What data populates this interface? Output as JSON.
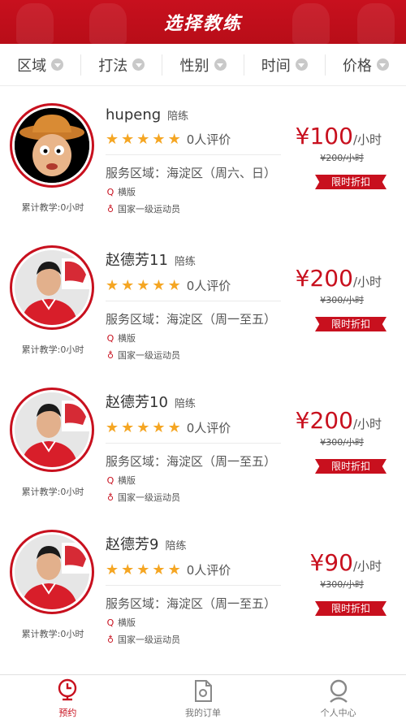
{
  "header": {
    "title": "选择教练"
  },
  "filters": [
    {
      "label": "区域"
    },
    {
      "label": "打法"
    },
    {
      "label": "性别"
    },
    {
      "label": "时间"
    },
    {
      "label": "价格"
    }
  ],
  "coaches": [
    {
      "name": "hupeng",
      "tag": "陪练",
      "stars": 5,
      "reviews": "0人评价",
      "area": "服务区域：海淀区（周六、日）",
      "style": "横版",
      "level": "国家一级运动员",
      "price": "¥100",
      "unit": "/小时",
      "old_price": "¥200/小时",
      "discount": "限时折扣",
      "total_teach": "累计教学:0小时",
      "avatar": "cartoon"
    },
    {
      "name": "赵德芳11",
      "tag": "陪练",
      "stars": 5,
      "reviews": "0人评价",
      "area": "服务区域：海淀区（周一至五）",
      "style": "横版",
      "level": "国家一级运动员",
      "price": "¥200",
      "unit": "/小时",
      "old_price": "¥300/小时",
      "discount": "限时折扣",
      "total_teach": "累计教学:0小时",
      "avatar": "photo"
    },
    {
      "name": "赵德芳10",
      "tag": "陪练",
      "stars": 5,
      "reviews": "0人评价",
      "area": "服务区域：海淀区（周一至五）",
      "style": "横版",
      "level": "国家一级运动员",
      "price": "¥200",
      "unit": "/小时",
      "old_price": "¥300/小时",
      "discount": "限时折扣",
      "total_teach": "累计教学:0小时",
      "avatar": "photo"
    },
    {
      "name": "赵德芳9",
      "tag": "陪练",
      "stars": 5,
      "reviews": "0人评价",
      "area": "服务区域：海淀区（周一至五）",
      "style": "横版",
      "level": "国家一级运动员",
      "price": "¥90",
      "unit": "/小时",
      "old_price": "¥300/小时",
      "discount": "限时折扣",
      "total_teach": "累计教学:0小时",
      "avatar": "photo"
    }
  ],
  "tabbar": [
    {
      "label": "预约",
      "active": true,
      "icon": "clock-pin-icon"
    },
    {
      "label": "我的订单",
      "active": false,
      "icon": "order-doc-icon"
    },
    {
      "label": "个人中心",
      "active": false,
      "icon": "person-icon"
    }
  ],
  "colors": {
    "brand_red": "#c8101e",
    "star": "#f5a623"
  }
}
